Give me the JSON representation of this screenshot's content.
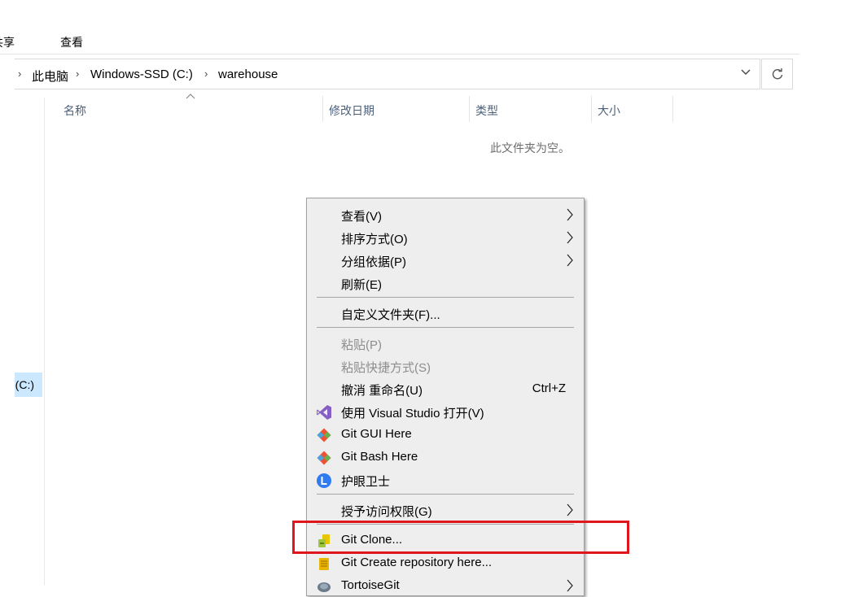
{
  "ribbon": {
    "share_tab": "共享",
    "view_tab": "查看"
  },
  "address_bar": {
    "segments": [
      "此电脑",
      "Windows-SSD (C:)",
      "warehouse"
    ],
    "refresh_icon": "refresh-icon",
    "dropdown_icon": "chevron-down-icon"
  },
  "nav": {
    "drive_label": "SSD (C:)"
  },
  "columns": {
    "name": "名称",
    "modified": "修改日期",
    "type": "类型",
    "size": "大小"
  },
  "empty_message": "此文件夹为空。",
  "context_menu": {
    "items": [
      {
        "label": "查看(V)",
        "submenu": true
      },
      {
        "label": "排序方式(O)",
        "submenu": true
      },
      {
        "label": "分组依据(P)",
        "submenu": true
      },
      {
        "label": "刷新(E)"
      },
      {
        "label": "自定义文件夹(F)..."
      },
      {
        "label": "粘贴(P)",
        "disabled": true
      },
      {
        "label": "粘贴快捷方式(S)",
        "disabled": true
      },
      {
        "label": "撤消 重命名(U)",
        "shortcut": "Ctrl+Z"
      },
      {
        "label": "使用 Visual Studio 打开(V)",
        "icon": "visual-studio-icon"
      },
      {
        "label": "Git GUI Here",
        "icon": "git-icon"
      },
      {
        "label": "Git Bash Here",
        "icon": "git-icon"
      },
      {
        "label": "护眼卫士",
        "icon": "eye-guard-icon"
      },
      {
        "label": "授予访问权限(G)",
        "submenu": true
      },
      {
        "label": "Git Clone...",
        "icon": "tortoisegit-clone-icon"
      },
      {
        "label": "Git Create repository here...",
        "icon": "tortoisegit-repo-icon"
      },
      {
        "label": "TortoiseGit",
        "icon": "tortoisegit-icon",
        "submenu": true
      }
    ]
  },
  "colors": {
    "highlight_border": "#e0161e",
    "menu_bg": "#eeeeee",
    "selection_bg": "#cce8ff"
  }
}
